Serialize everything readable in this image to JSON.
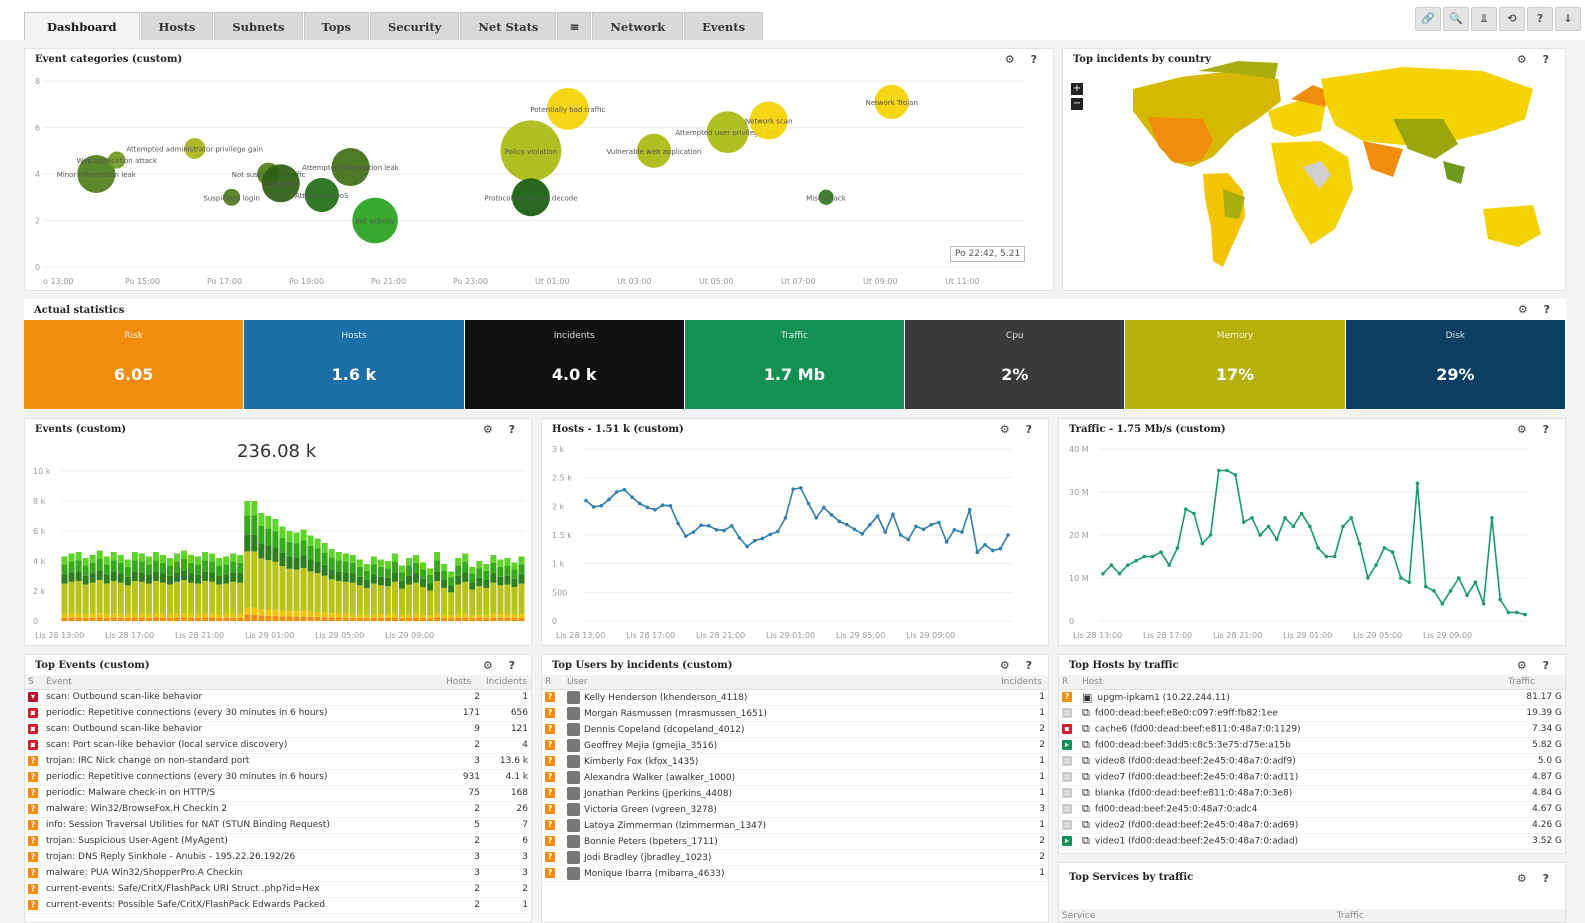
{
  "tabs": [
    "Dashboard",
    "Hosts",
    "Subnets",
    "Tops",
    "Security",
    "Net Stats",
    "≡",
    "Network",
    "Events"
  ],
  "toolbar": [
    "🔗",
    "🔍",
    "⫫",
    "⟲",
    "?",
    "↓"
  ],
  "colors": {
    "orange": "#f28c0b",
    "blue": "#1a6fa8",
    "black": "#111111",
    "green": "#139152",
    "dark": "#3a3a3a",
    "olive": "#b6b10a",
    "navy": "#0a3f64",
    "line_blue": "#2f7fb0",
    "line_green": "#1a9b6a"
  },
  "panel_tools": "⚙ ?",
  "bubble": {
    "title": "Event categories (custom)",
    "tooltip": "Po 22:42, 5.21",
    "y_ticks": [
      "8",
      "6",
      "4",
      "2",
      "0"
    ],
    "x_ticks": [
      "o 13:00",
      "Po 15:00",
      "Po 17:00",
      "Po 19:00",
      "Po 21:00",
      "Po 23:00",
      "Ut 01:00",
      "Ut 03:00",
      "Ut 05:00",
      "Ut 07:00",
      "Ut 09:00",
      "Ut 11:00"
    ],
    "bubbles": [
      {
        "label": "Minor information leak",
        "t": 14.3,
        "v": 4.0,
        "r": 1.0,
        "c": "#4e7d1a"
      },
      {
        "label": "Web application attack",
        "t": 14.8,
        "v": 4.6,
        "r": 0.45,
        "c": "#6c9a20"
      },
      {
        "label": "Attempted administrator privilege gain",
        "t": 16.7,
        "v": 5.1,
        "r": 0.55,
        "c": "#a7b512"
      },
      {
        "label": "Not suspicious traffic",
        "t": 18.5,
        "v": 4.0,
        "r": 0.6,
        "c": "#4e7d1a"
      },
      {
        "label": "Suspicious login",
        "t": 17.6,
        "v": 3.0,
        "r": 0.45,
        "c": "#4e7d1a"
      },
      {
        "label": "Unknown",
        "t": 18.8,
        "v": 3.6,
        "r": 1.0,
        "c": "#2d5e12"
      },
      {
        "label": "Attempted DoS",
        "t": 19.8,
        "v": 3.1,
        "r": 0.9,
        "c": "#1f6d15"
      },
      {
        "label": "Attempted information leak",
        "t": 20.5,
        "v": 4.3,
        "r": 1.0,
        "c": "#3f6e14"
      },
      {
        "label": "Bot activity",
        "t": 21.1,
        "v": 2.0,
        "r": 1.2,
        "c": "#27a21d"
      },
      {
        "label": "Policy violation",
        "t": 24.9,
        "v": 5.0,
        "r": 1.6,
        "c": "#a9bb0f"
      },
      {
        "label": "Protocol command decode",
        "t": 24.9,
        "v": 3.0,
        "r": 1.0,
        "c": "#155c0c"
      },
      {
        "label": "Potentially bad traffic",
        "t": 25.8,
        "v": 6.8,
        "r": 1.1,
        "c": "#f5d100"
      },
      {
        "label": "Vulnerable web application",
        "t": 27.9,
        "v": 5.0,
        "r": 0.9,
        "c": "#a9bb0f"
      },
      {
        "label": "Attempted user privilege gain",
        "t": 29.7,
        "v": 5.8,
        "r": 1.1,
        "c": "#a9bb0f"
      },
      {
        "label": "Network scan",
        "t": 30.7,
        "v": 6.3,
        "r": 1.0,
        "c": "#f5d100"
      },
      {
        "label": "Misc attack",
        "t": 32.1,
        "v": 3.0,
        "r": 0.4,
        "c": "#2d7a1c"
      },
      {
        "label": "Network Trojan",
        "t": 33.7,
        "v": 7.1,
        "r": 0.9,
        "c": "#f5d100"
      }
    ]
  },
  "map": {
    "title": "Top incidents by country",
    "zoom_in": "+",
    "zoom_out": "−"
  },
  "stats": {
    "title": "Actual statistics",
    "tiles": [
      {
        "label": "Risk",
        "value": "6.05",
        "color": "#f28c0b"
      },
      {
        "label": "Hosts",
        "value": "1.6 k",
        "color": "#1a6fa8"
      },
      {
        "label": "Incidents",
        "value": "4.0 k",
        "color": "#111111"
      },
      {
        "label": "Traffic",
        "value": "1.7 Mb",
        "color": "#139152"
      },
      {
        "label": "Cpu",
        "value": "2%",
        "color": "#3a3a3a"
      },
      {
        "label": "Memory",
        "value": "17%",
        "color": "#b6b10a"
      },
      {
        "label": "Disk",
        "value": "29%",
        "color": "#0a3f64"
      }
    ]
  },
  "events": {
    "title": "Events (custom)",
    "total": "236.08 k",
    "y_ticks": [
      "10 k",
      "8 k",
      "6 k",
      "4 k",
      "2 k",
      "0"
    ],
    "x_ticks": [
      "Lis 28 13:00",
      "Lis 28 17:00",
      "Lis 28 21:00",
      "Lis 29 01:00",
      "Lis 29 05:00",
      "Lis 29 09:00"
    ],
    "totals": [
      4.3,
      4.5,
      4.6,
      4.2,
      4.4,
      4.7,
      4.3,
      4.6,
      4.4,
      4.1,
      4.6,
      4.5,
      4.3,
      4.6,
      4.4,
      4.2,
      4.5,
      4.7,
      4.4,
      4.3,
      4.6,
      4.5,
      4.2,
      4.3,
      4.5,
      4.4,
      8.0,
      8.0,
      7.2,
      7.0,
      6.8,
      6.3,
      6.0,
      5.9,
      6.1,
      5.7,
      5.5,
      5.2,
      4.8,
      4.6,
      4.5,
      4.4,
      4.1,
      3.8,
      4.3,
      4.1,
      4.0,
      4.5,
      3.7,
      4.2,
      4.4,
      3.9,
      3.5,
      4.6,
      3.8,
      3.3,
      4.2,
      4.5,
      3.6,
      4.0,
      3.8,
      4.4,
      4.1,
      4.2,
      3.9,
      4.3
    ]
  },
  "hosts_chart": {
    "title": "Hosts - 1.51 k (custom)",
    "y_ticks": [
      "3 k",
      "2.5 k",
      "2 k",
      "1.5 k",
      "1 k",
      "500",
      "0"
    ],
    "x_ticks": [
      "Lis 28 13:00",
      "Lis 28 17:00",
      "Lis 28 21:00",
      "Lis 29 01:00",
      "Lis 29 05:00",
      "Lis 29 09:00"
    ],
    "values": [
      2100,
      1990,
      2010,
      2120,
      2250,
      2290,
      2160,
      2050,
      1980,
      1940,
      2020,
      2010,
      1700,
      1480,
      1550,
      1670,
      1660,
      1590,
      1580,
      1660,
      1450,
      1300,
      1400,
      1440,
      1510,
      1560,
      1800,
      2300,
      2320,
      2050,
      1800,
      1980,
      1850,
      1740,
      1680,
      1600,
      1520,
      1680,
      1830,
      1550,
      1860,
      1500,
      1420,
      1650,
      1600,
      1680,
      1720,
      1380,
      1590,
      1550,
      1940,
      1200,
      1330,
      1230,
      1260,
      1500
    ]
  },
  "traffic_chart": {
    "title": "Traffic - 1.75 Mb/s (custom)",
    "y_ticks": [
      "40 M",
      "30 M",
      "20 M",
      "10 M",
      "0"
    ],
    "x_ticks": [
      "Lis 28 13:00",
      "Lis 28 17:00",
      "Lis 28 21:00",
      "Lis 29 01:00",
      "Lis 29 05:00",
      "Lis 29 09:00"
    ],
    "values": [
      11,
      13,
      11,
      13,
      14,
      15,
      15,
      16,
      13,
      17,
      26,
      25,
      18,
      20,
      35,
      35,
      34,
      23,
      24,
      20,
      22,
      19,
      24,
      22,
      25,
      22,
      17,
      15,
      15,
      22,
      24,
      18,
      10,
      13,
      17,
      16,
      10,
      9,
      32,
      8,
      7,
      4,
      7,
      10,
      6,
      9,
      4,
      24,
      5,
      2,
      2,
      1.5
    ]
  },
  "top_events": {
    "title": "Top Events (custom)",
    "cols": [
      "S",
      "Event",
      "Hosts",
      "Incidents"
    ],
    "rows": [
      {
        "s": "#c0102a",
        "g": "▾",
        "event": "scan: Outbound scan-like behavior",
        "hosts": "2",
        "inc": "1"
      },
      {
        "s": "#d41f2a",
        "g": "▪",
        "event": "periodic: Repetitive connections (every 30 minutes in 6 hours)",
        "hosts": "171",
        "inc": "656"
      },
      {
        "s": "#d41f2a",
        "g": "▪",
        "event": "scan: Outbound scan-like behavior",
        "hosts": "9",
        "inc": "121"
      },
      {
        "s": "#d41f2a",
        "g": "▪",
        "event": "scan: Port scan-like behavior (local service discovery)",
        "hosts": "2",
        "inc": "4"
      },
      {
        "s": "#f28c0b",
        "g": "?",
        "event": "trojan: IRC Nick change on non-standard port",
        "hosts": "3",
        "inc": "13.6 k"
      },
      {
        "s": "#f28c0b",
        "g": "?",
        "event": "periodic: Repetitive connections (every 30 minutes in 6 hours)",
        "hosts": "931",
        "inc": "4.1 k"
      },
      {
        "s": "#f28c0b",
        "g": "?",
        "event": "periodic: Malware check-in on HTTP/S",
        "hosts": "75",
        "inc": "168"
      },
      {
        "s": "#f28c0b",
        "g": "?",
        "event": "malware: Win32/BrowseFox.H Checkin 2",
        "hosts": "2",
        "inc": "26"
      },
      {
        "s": "#f28c0b",
        "g": "?",
        "event": "info: Session Traversal Utilities for NAT (STUN Binding Request)",
        "hosts": "5",
        "inc": "7"
      },
      {
        "s": "#f28c0b",
        "g": "?",
        "event": "trojan: Suspicious User-Agent (MyAgent)",
        "hosts": "2",
        "inc": "6"
      },
      {
        "s": "#f28c0b",
        "g": "?",
        "event": "trojan: DNS Reply Sinkhole - Anubis - 195.22.26.192/26",
        "hosts": "3",
        "inc": "3"
      },
      {
        "s": "#f28c0b",
        "g": "?",
        "event": "malware: PUA Win32/ShopperPro.A Checkin",
        "hosts": "3",
        "inc": "3"
      },
      {
        "s": "#f28c0b",
        "g": "?",
        "event": "current-events: Safe/CritX/FlashPack URI Struct .php?id=Hex",
        "hosts": "2",
        "inc": "2"
      },
      {
        "s": "#f28c0b",
        "g": "?",
        "event": "current-events: Possible Safe/CritX/FlashPack Edwards Packed",
        "hosts": "2",
        "inc": "1"
      }
    ]
  },
  "top_users": {
    "title": "Top Users by incidents (custom)",
    "cols": [
      "R",
      "User",
      "Incidents"
    ],
    "rows": [
      {
        "user": "Kelly Henderson (khenderson_4118)",
        "inc": "1"
      },
      {
        "user": "Morgan Rasmussen (mrasmussen_1651)",
        "inc": "1"
      },
      {
        "user": "Dennis Copeland (dcopeland_4012)",
        "inc": "2"
      },
      {
        "user": "Geoffrey Mejia (gmejia_3516)",
        "inc": "2"
      },
      {
        "user": "Kimberly Fox (kfox_1435)",
        "inc": "1"
      },
      {
        "user": "Alexandra Walker (awalker_1000)",
        "inc": "1"
      },
      {
        "user": "Jonathan Perkins (jperkins_4408)",
        "inc": "1"
      },
      {
        "user": "Victoria Green (vgreen_3278)",
        "inc": "3"
      },
      {
        "user": "Latoya Zimmerman (lzimmerman_1347)",
        "inc": "1"
      },
      {
        "user": "Bonnie Peters (bpeters_1711)",
        "inc": "2"
      },
      {
        "user": "Jodi Bradley (jbradley_1023)",
        "inc": "2"
      },
      {
        "user": "Monique Ibarra (mibarra_4633)",
        "inc": "1"
      }
    ]
  },
  "top_hosts": {
    "title": "Top Hosts by traffic",
    "cols": [
      "R",
      "Host",
      "Traffic"
    ],
    "rows": [
      {
        "r": "#f28c0b",
        "g": "?",
        "icon": "server",
        "host": "upgm-ipkam1 (10.22.244.11)",
        "traffic": "81.17 G"
      },
      {
        "r": "#cccccc",
        "g": "▫",
        "icon": "network",
        "host": "fd00:dead:beef:e8e0:c097:e9ff:fb82:1ee",
        "traffic": "19.39 G"
      },
      {
        "r": "#d41f2a",
        "g": "▪",
        "icon": "network",
        "host": "cache6 (fd00:dead:beef:e811:0:48a7:0:1129)",
        "traffic": "7.34 G"
      },
      {
        "r": "#139152",
        "g": "▸",
        "icon": "network",
        "host": "fd00:dead:beef:3dd5:c8c5:3e75:d75e:a15b",
        "traffic": "5.82 G"
      },
      {
        "r": "#cccccc",
        "g": "▫",
        "icon": "network",
        "host": "video8 (fd00:dead:beef:2e45:0:48a7:0:adf9)",
        "traffic": "5.0 G"
      },
      {
        "r": "#cccccc",
        "g": "▫",
        "icon": "network",
        "host": "video7 (fd00:dead:beef:2e45:0:48a7:0:ad11)",
        "traffic": "4.87 G"
      },
      {
        "r": "#cccccc",
        "g": "▫",
        "icon": "network",
        "host": "blanka (fd00:dead:beef:e811:0:48a7:0:3e8)",
        "traffic": "4.84 G"
      },
      {
        "r": "#cccccc",
        "g": "▫",
        "icon": "network",
        "host": "fd00:dead:beef:2e45:0:48a7:0:adc4",
        "traffic": "4.67 G"
      },
      {
        "r": "#cccccc",
        "g": "▫",
        "icon": "network",
        "host": "video2 (fd00:dead:beef:2e45:0:48a7:0:ad69)",
        "traffic": "4.26 G"
      },
      {
        "r": "#139152",
        "g": "▸",
        "icon": "network",
        "host": "video1 (fd00:dead:beef:2e45:0:48a7:0:adad)",
        "traffic": "3.52 G"
      }
    ]
  },
  "top_services": {
    "title": "Top Services by traffic",
    "cols": [
      "Service",
      "Traffic"
    ]
  }
}
